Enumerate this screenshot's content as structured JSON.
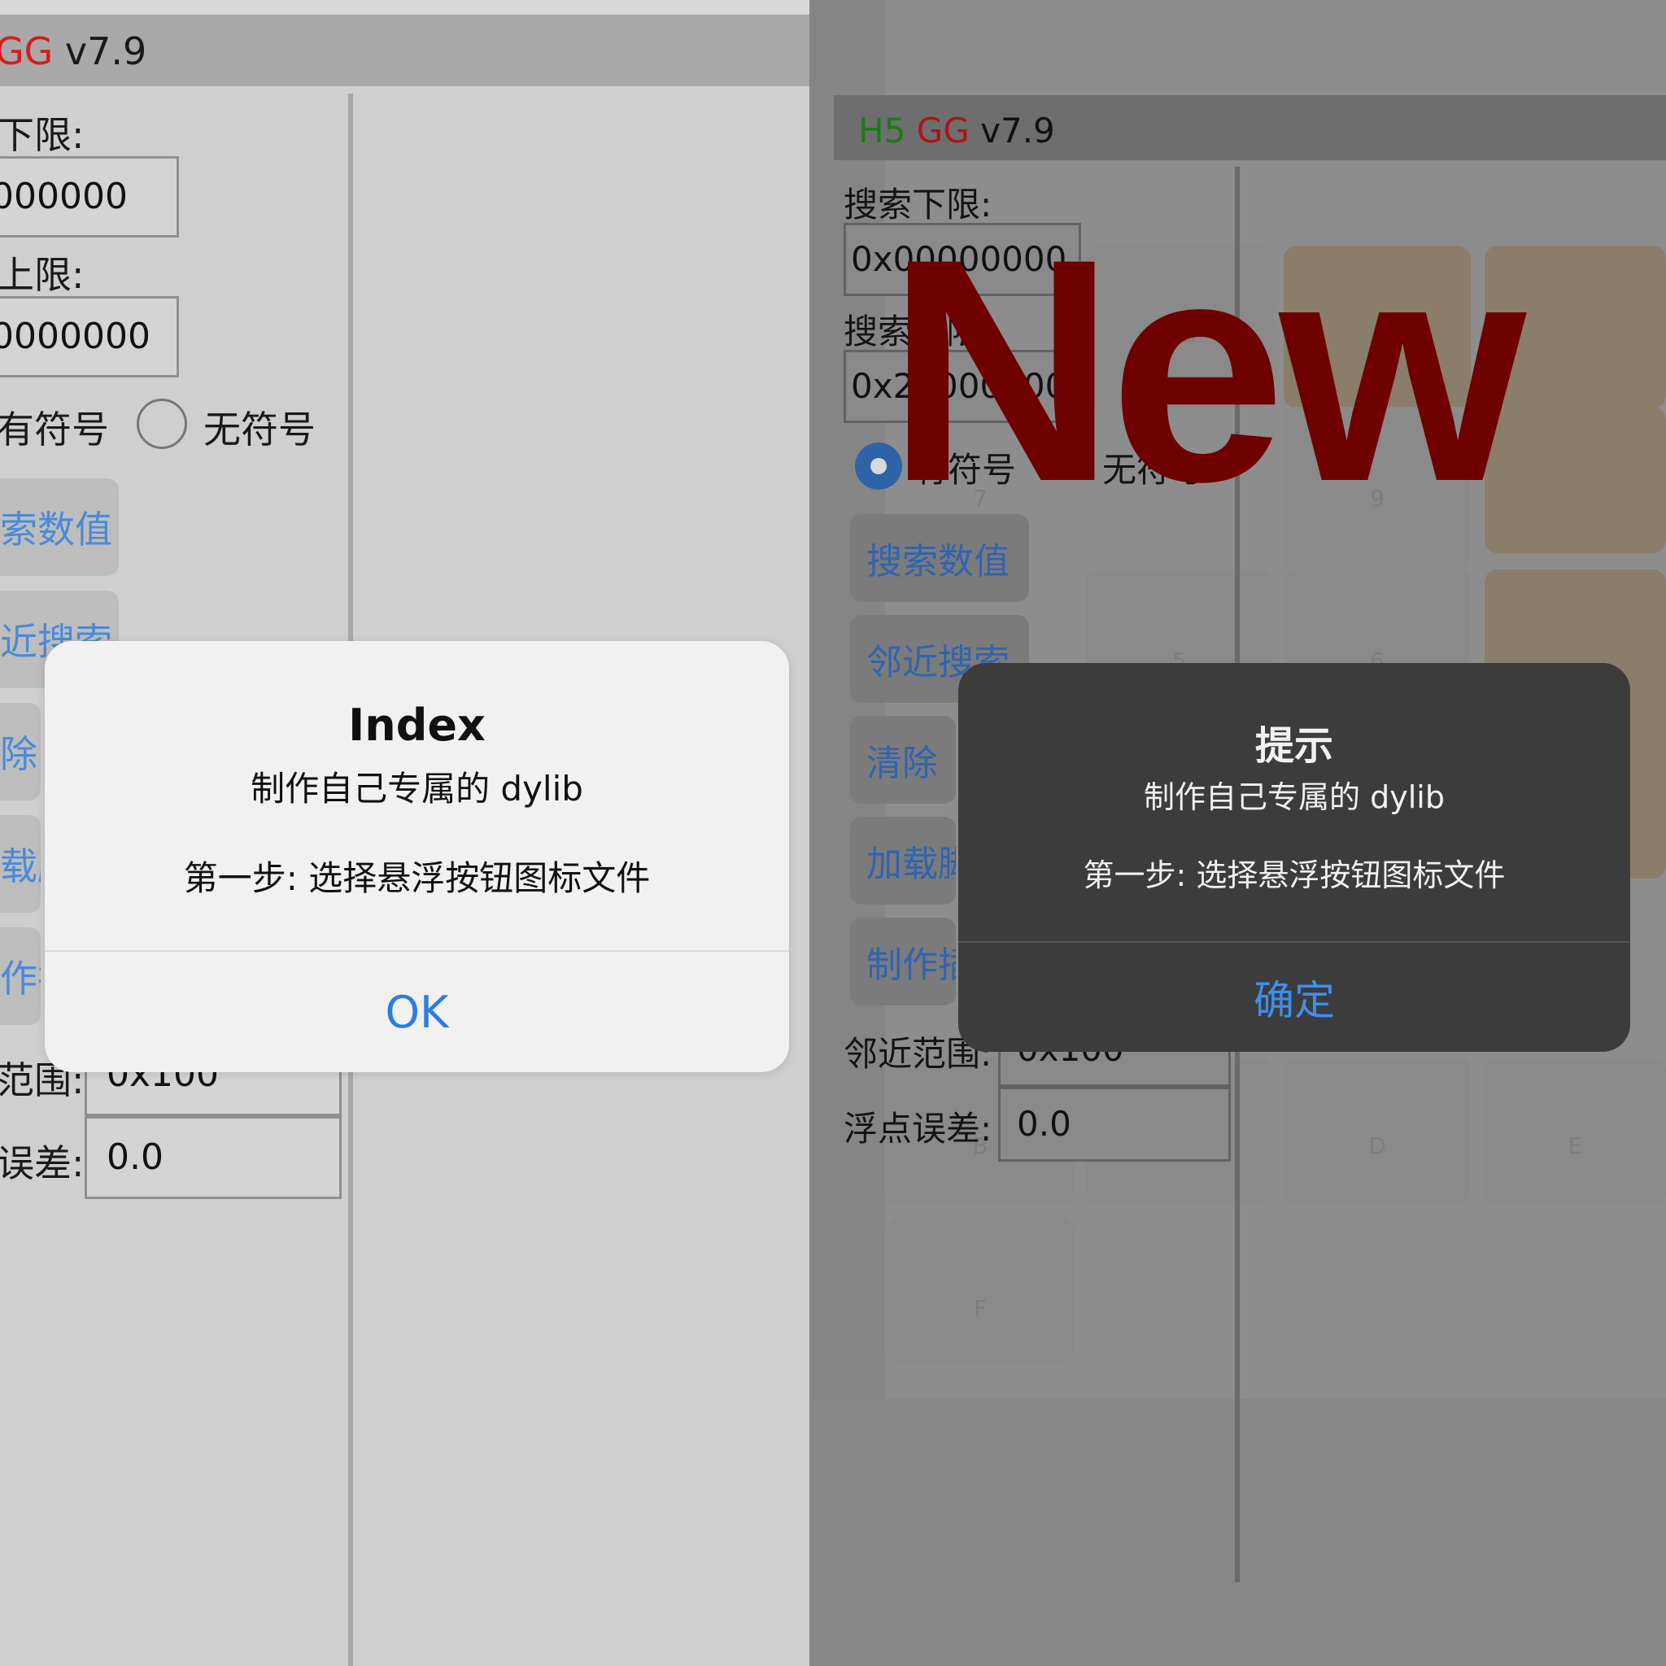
{
  "left": {
    "title_prefix": "GG",
    "title_version": " v7.9",
    "label_lower": "下限:",
    "lower_value": "000000",
    "label_upper": "上限:",
    "upper_value": "0000000",
    "radio_signed": "有符号",
    "radio_unsigned": "无符号",
    "btn_search": "索数值",
    "btn_nearby": "近搜索",
    "btn_clear": "除",
    "btn_load": "载脚",
    "btn_make": "作插",
    "label_range": "范围:",
    "range_value": "0x100",
    "label_float": "误差:",
    "float_value": "0.0",
    "alert": {
      "title": "Index",
      "line1": "制作自己专属的 dylib",
      "line2": "第一步: 选择悬浮按钮图标文件",
      "ok": "OK"
    }
  },
  "right": {
    "title_h5": "H5",
    "title_gg": "GG",
    "title_version": " v7.9",
    "label_lower": "搜索下限:",
    "lower_value": "0x00000000",
    "label_upper": "搜索上限:",
    "upper_value": "0x20000000",
    "radio_signed": "有符号",
    "radio_unsigned": "无符号",
    "btn_search": "搜索数值",
    "btn_nearby": "邻近搜索",
    "btn_clear": "清除",
    "btn_load": "加载脚",
    "btn_make": "制作插",
    "label_range": "邻近范围:",
    "range_value": "0x100",
    "label_float": "浮点误差:",
    "float_value": "0.0",
    "keypad": [
      "⌫",
      "=",
      "/",
      "7",
      "9",
      "5",
      "6",
      "B",
      "C",
      "D",
      "E",
      "F"
    ],
    "alert": {
      "title": "提示",
      "line1": "制作自己专属的 dylib",
      "line2": "第一步: 选择悬浮按钮图标文件",
      "ok": "确定"
    }
  },
  "overlay_text": "New",
  "colors": {
    "gg_red": "#d81b1b",
    "h5_green": "#1a7a1a",
    "ios_blue": "#2a7de1",
    "new_overlay": "#6e0000"
  }
}
